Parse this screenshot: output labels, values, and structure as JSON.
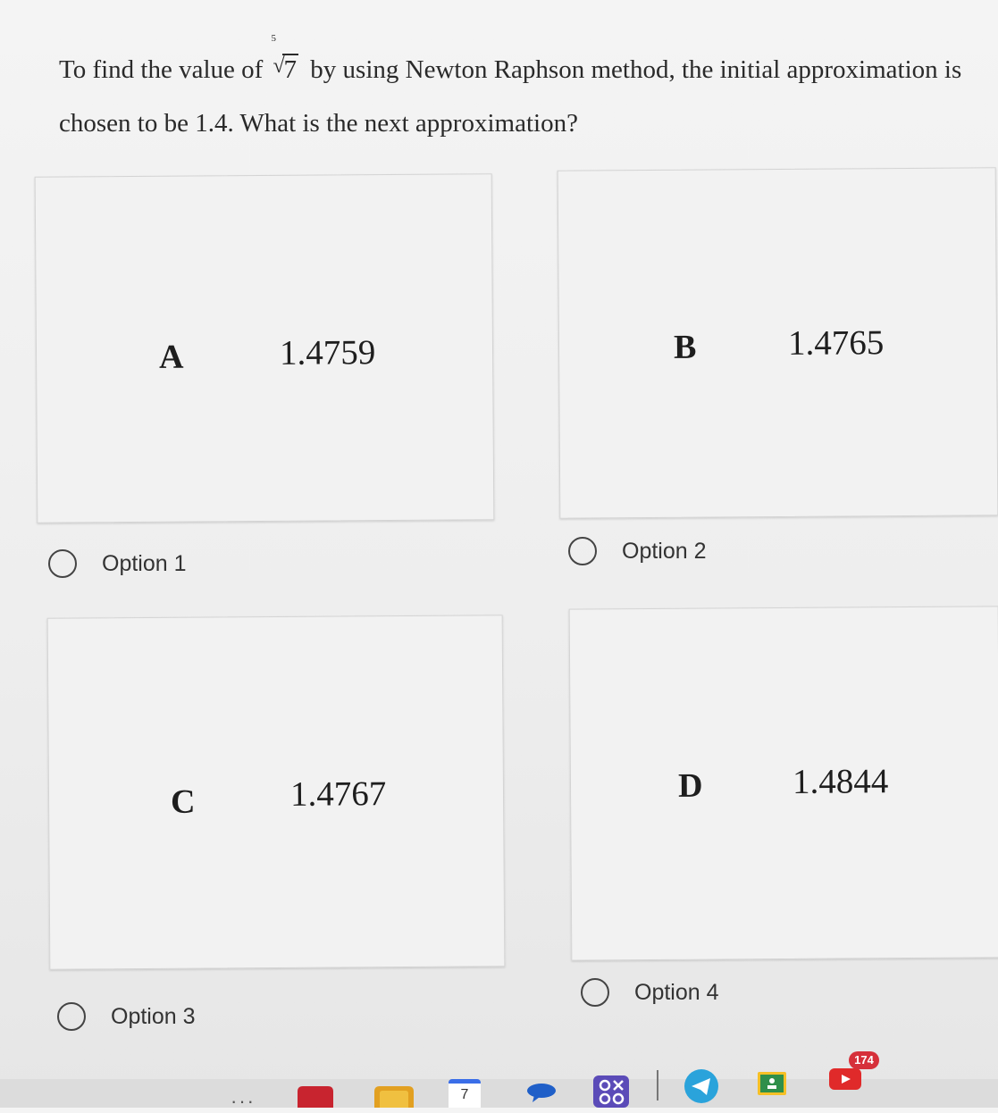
{
  "question": {
    "text_before": "To find the value of",
    "root_index": "5",
    "root_radicand": "7",
    "text_after": "by using Newton Raphson method, the initial approximation is chosen to be 1.4. What is the next approximation?"
  },
  "choices": [
    {
      "letter": "A",
      "value": "1.4759",
      "option_label": "Option 1"
    },
    {
      "letter": "B",
      "value": "1.4765",
      "option_label": "Option 2"
    },
    {
      "letter": "C",
      "value": "1.4767",
      "option_label": "Option 3"
    },
    {
      "letter": "D",
      "value": "1.4844",
      "option_label": "Option 4"
    }
  ],
  "taskbar": {
    "calendar_day": "7",
    "notification_count": "174",
    "icons": [
      "more-icon",
      "app-red-icon",
      "app-yellow-icon",
      "calendar-icon",
      "chat-icon",
      "games-icon",
      "telegram-icon",
      "classroom-icon",
      "youtube-icon"
    ]
  }
}
